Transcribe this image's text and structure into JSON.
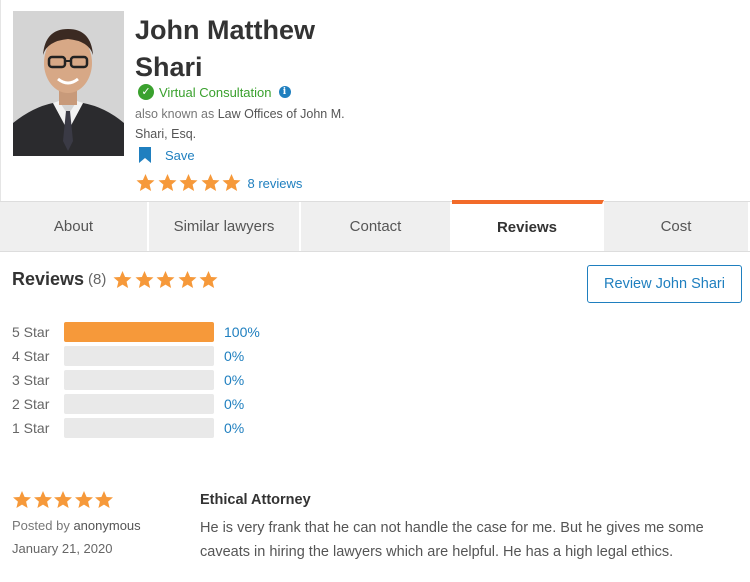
{
  "profile": {
    "name": "John Matthew Shari",
    "virtual_consultation": "Virtual Consultation",
    "aka_prefix": "also known as",
    "aka_name": "Law Offices of John M. Shari, Esq.",
    "save_label": "Save",
    "rating": 5,
    "reviews_link": "8 reviews"
  },
  "tabs": [
    {
      "label": "About",
      "active": false
    },
    {
      "label": "Similar lawyers",
      "active": false
    },
    {
      "label": "Contact",
      "active": false
    },
    {
      "label": "Reviews",
      "active": true
    },
    {
      "label": "Cost",
      "active": false
    }
  ],
  "reviews": {
    "title": "Reviews",
    "count": "(8)",
    "rating": 5,
    "write_button": "Review John Shari",
    "distribution": [
      {
        "label": "5 Star",
        "percent_text": "100%",
        "fraction": 1.0
      },
      {
        "label": "4 Star",
        "percent_text": "0%",
        "fraction": 0
      },
      {
        "label": "3 Star",
        "percent_text": "0%",
        "fraction": 0
      },
      {
        "label": "2 Star",
        "percent_text": "0%",
        "fraction": 0
      },
      {
        "label": "1 Star",
        "percent_text": "0%",
        "fraction": 0
      }
    ],
    "items": [
      {
        "rating": 5,
        "posted_prefix": "Posted by",
        "author": "anonymous",
        "date": "January 21, 2020",
        "title": "Ethical Attorney",
        "body": "He is very frank that he can not handle the case for me. But he gives me some caveats in hiring the lawyers which are helpful. He has a high legal ethics."
      }
    ]
  },
  "colors": {
    "star": "#f6993a",
    "accent_blue": "#1f7fbf",
    "active_tab": "#f26b2a",
    "green": "#3aa12e"
  },
  "icons": {
    "check": "check-circle-icon",
    "info": "info-icon",
    "save": "bookmark-icon",
    "star": "star-icon"
  }
}
